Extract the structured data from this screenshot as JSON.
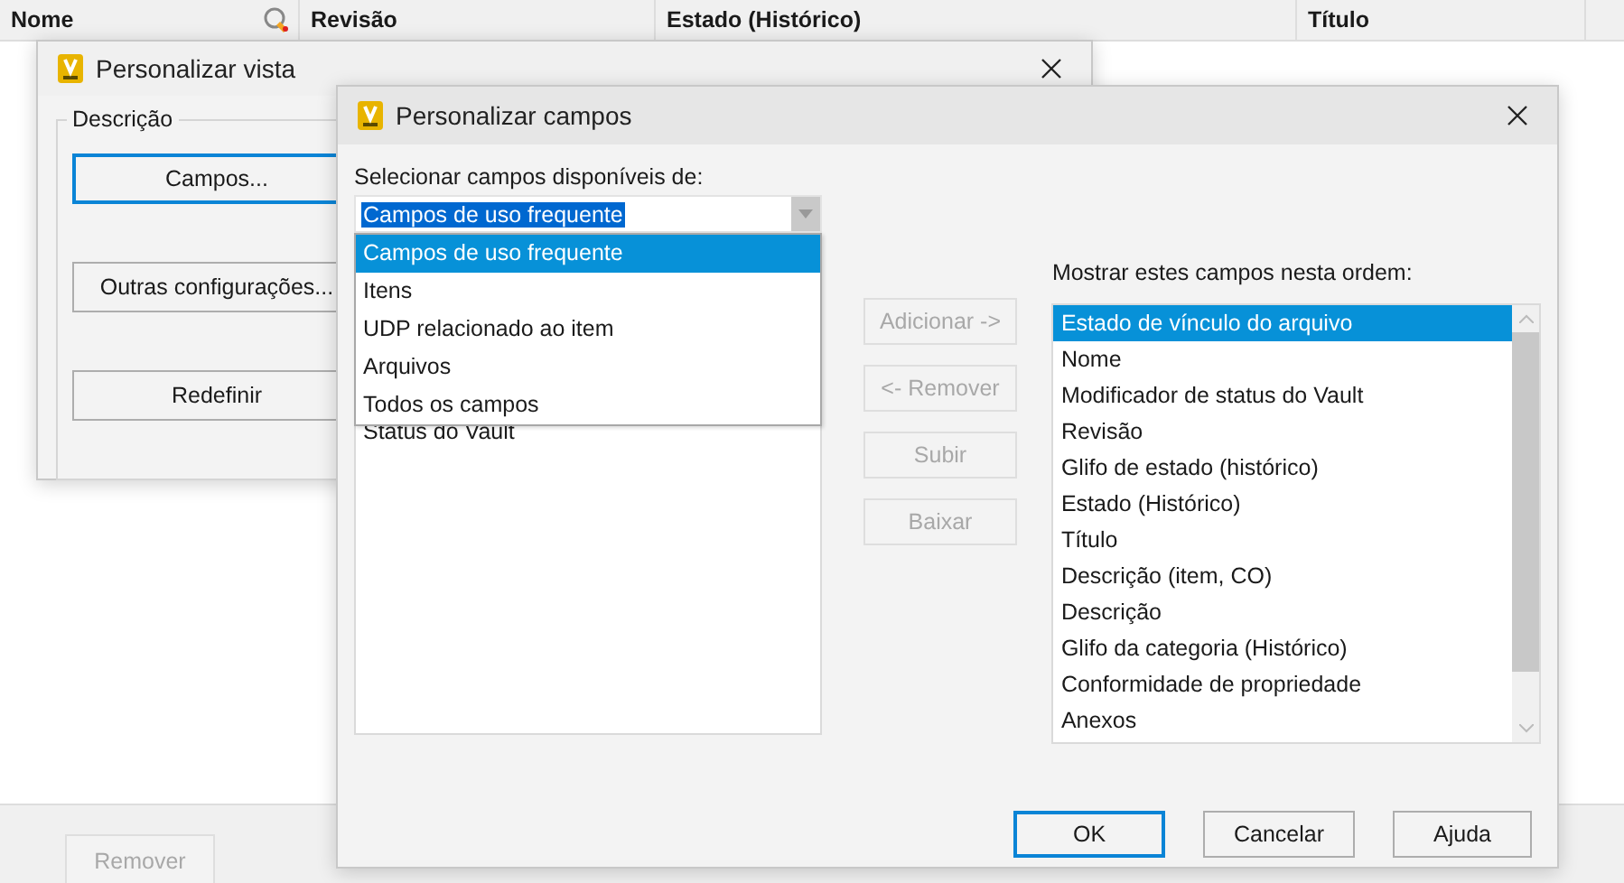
{
  "table_header": {
    "columns": [
      "Nome",
      "Revisão",
      "Estado (Histórico)",
      "Título"
    ]
  },
  "bottom_bar": {
    "buttons": [
      {
        "label": "Remover",
        "disabled": true
      }
    ]
  },
  "vista_dialog": {
    "title": "Personalizar vista",
    "group_label": "Descrição",
    "buttons": [
      {
        "label": "Campos...",
        "focused": true
      },
      {
        "label": "Outras configurações...",
        "focused": false
      },
      {
        "label": "Redefinir",
        "focused": false
      }
    ]
  },
  "campos_dialog": {
    "title": "Personalizar campos",
    "source_label": "Selecionar campos disponíveis de:",
    "source_combo": {
      "value": "Campos de uso frequente",
      "expanded": true,
      "options": [
        {
          "label": "Campos de uso frequente",
          "selected": true
        },
        {
          "label": "Itens",
          "selected": false
        },
        {
          "label": "UDP relacionado ao item",
          "selected": false
        },
        {
          "label": "Arquivos",
          "selected": false
        },
        {
          "label": "Todos os campos",
          "selected": false
        }
      ]
    },
    "available_fields": [
      {
        "label": "Status do Vault"
      }
    ],
    "buttons": [
      {
        "label": "Adicionar ->",
        "disabled": true
      },
      {
        "label": "<- Remover",
        "disabled": true
      },
      {
        "label": "Subir",
        "disabled": true
      },
      {
        "label": "Baixar",
        "disabled": true
      }
    ],
    "shown_label": "Mostrar estes campos nesta ordem:",
    "shown_fields": [
      {
        "label": "Estado de vínculo do arquivo",
        "selected": true
      },
      {
        "label": "Nome",
        "selected": false
      },
      {
        "label": "Modificador de status do Vault",
        "selected": false
      },
      {
        "label": "Revisão",
        "selected": false
      },
      {
        "label": "Glifo de estado (histórico)",
        "selected": false
      },
      {
        "label": "Estado (Histórico)",
        "selected": false
      },
      {
        "label": "Título",
        "selected": false
      },
      {
        "label": "Descrição (item, CO)",
        "selected": false
      },
      {
        "label": "Descrição",
        "selected": false
      },
      {
        "label": "Glifo da categoria (Histórico)",
        "selected": false
      },
      {
        "label": "Conformidade de propriedade",
        "selected": false
      },
      {
        "label": "Anexos",
        "selected": false
      }
    ],
    "footer_buttons": [
      {
        "label": "OK",
        "focused": true
      },
      {
        "label": "Cancelar",
        "focused": false
      },
      {
        "label": "Ajuda",
        "focused": false
      }
    ]
  }
}
